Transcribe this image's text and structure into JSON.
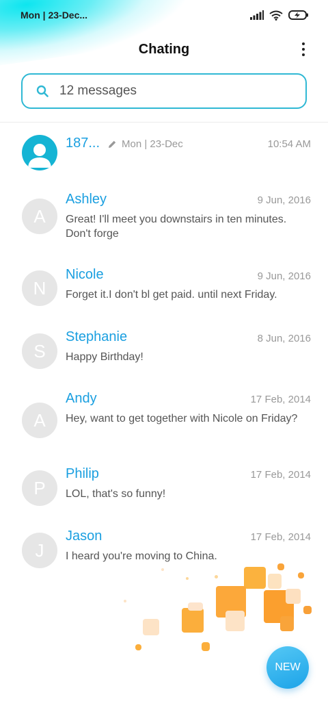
{
  "status_bar": {
    "time_date": "Mon | 23-Dec..."
  },
  "header": {
    "title": "Chating"
  },
  "search": {
    "text": "12 messages"
  },
  "draft": {
    "name": "187...",
    "subtitle": "Mon | 23-Dec",
    "time": "10:54 AM"
  },
  "conversations": [
    {
      "initial": "A",
      "name": "Ashley",
      "date": "9 Jun, 2016",
      "snippet": "Great! I'll meet you downstairs in ten minutes. Don't forge"
    },
    {
      "initial": "N",
      "name": "Nicole",
      "date": "9 Jun, 2016",
      "snippet": "Forget it.I don't bl get paid. until next Friday."
    },
    {
      "initial": "S",
      "name": "Stephanie",
      "date": "8 Jun, 2016",
      "snippet": "Happy Birthday!"
    },
    {
      "initial": "A",
      "name": "Andy",
      "date": "17 Feb, 2014",
      "snippet": "Hey, want to get together with Nicole on Friday?"
    },
    {
      "initial": "P",
      "name": "Philip",
      "date": "17 Feb, 2014",
      "snippet": "LOL, that's so funny!"
    },
    {
      "initial": "J",
      "name": "Jason",
      "date": "17 Feb, 2014",
      "snippet": "I heard you're moving to China."
    }
  ],
  "fab": {
    "label": "NEW"
  },
  "colors": {
    "accent": "#1a9fe0",
    "search_border": "#2fb8d4",
    "avatar_gray": "#e6e6e6",
    "deco_orange": "#fbae3c"
  },
  "icons": {
    "search": "search-icon",
    "more": "more-vert-icon",
    "pencil": "pencil-icon",
    "signal": "signal-icon",
    "wifi": "wifi-icon",
    "battery": "battery-charging-icon",
    "person": "person-icon"
  }
}
